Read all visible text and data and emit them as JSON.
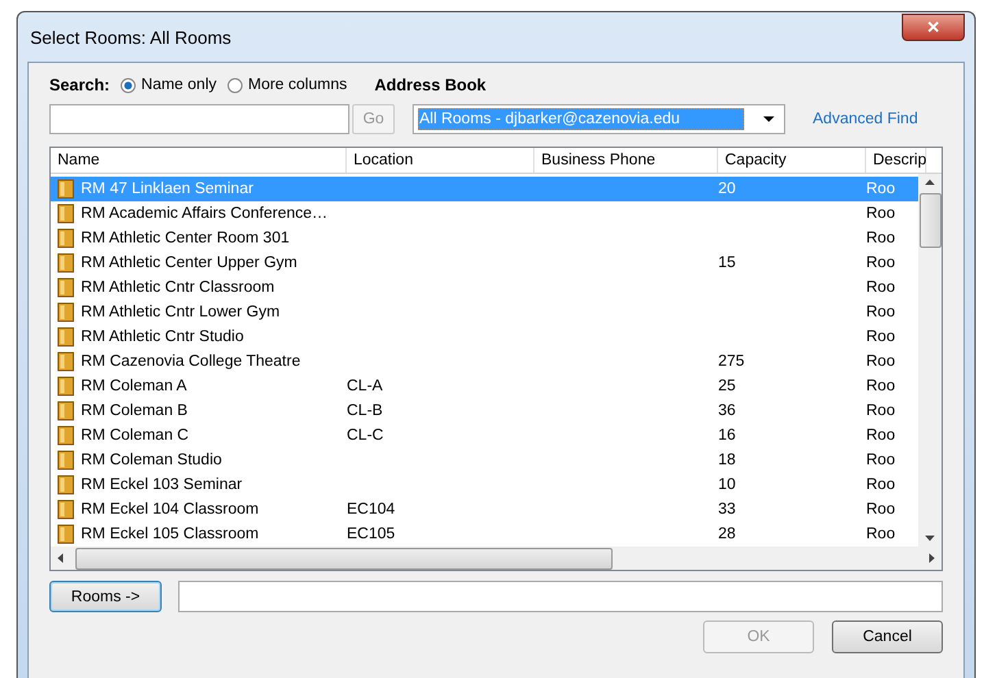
{
  "window": {
    "title": "Select Rooms: All Rooms",
    "close": "✕"
  },
  "search": {
    "label": "Search:",
    "options": [
      {
        "label": "Name only",
        "selected": true
      },
      {
        "label": "More columns",
        "selected": false
      }
    ],
    "go": "Go"
  },
  "address_book": {
    "label": "Address Book",
    "value": "All Rooms - djbarker@cazenovia.edu",
    "advanced": "Advanced Find"
  },
  "table": {
    "columns": [
      "Name",
      "Location",
      "Business Phone",
      "Capacity",
      "Descrip"
    ],
    "rows": [
      {
        "name": "RM 47 Linklaen Seminar",
        "location": "",
        "capacity": "20",
        "description": "Roo",
        "selected": true
      },
      {
        "name": "RM Academic Affairs Conference…",
        "location": "",
        "capacity": "",
        "description": "Roo",
        "selected": false
      },
      {
        "name": "RM Athletic Center Room 301",
        "location": "",
        "capacity": "",
        "description": "Roo",
        "selected": false
      },
      {
        "name": "RM Athletic Center Upper Gym",
        "location": "",
        "capacity": "15",
        "description": "Roo",
        "selected": false
      },
      {
        "name": "RM Athletic Cntr Classroom",
        "location": "",
        "capacity": "",
        "description": "Roo",
        "selected": false
      },
      {
        "name": "RM Athletic Cntr Lower Gym",
        "location": "",
        "capacity": "",
        "description": "Roo",
        "selected": false
      },
      {
        "name": "RM Athletic Cntr Studio",
        "location": "",
        "capacity": "",
        "description": "Roo",
        "selected": false
      },
      {
        "name": "RM Cazenovia College Theatre",
        "location": "",
        "capacity": "275",
        "description": "Roo",
        "selected": false
      },
      {
        "name": "RM Coleman A",
        "location": "CL-A",
        "capacity": "25",
        "description": "Roo",
        "selected": false
      },
      {
        "name": "RM Coleman B",
        "location": "CL-B",
        "capacity": "36",
        "description": "Roo",
        "selected": false
      },
      {
        "name": "RM Coleman C",
        "location": "CL-C",
        "capacity": "16",
        "description": "Roo",
        "selected": false
      },
      {
        "name": "RM Coleman Studio",
        "location": "",
        "capacity": "18",
        "description": "Roo",
        "selected": false
      },
      {
        "name": "RM Eckel 103 Seminar",
        "location": "",
        "capacity": "10",
        "description": "Roo",
        "selected": false
      },
      {
        "name": "RM Eckel 104 Classroom",
        "location": "EC104",
        "capacity": "33",
        "description": "Roo",
        "selected": false
      },
      {
        "name": "RM Eckel 105 Classroom",
        "location": "EC105",
        "capacity": "28",
        "description": "Roo",
        "selected": false
      }
    ]
  },
  "rooms_button": "Rooms ->",
  "buttons": [
    {
      "label": "OK",
      "disabled": true
    },
    {
      "label": "Cancel",
      "disabled": false
    }
  ]
}
